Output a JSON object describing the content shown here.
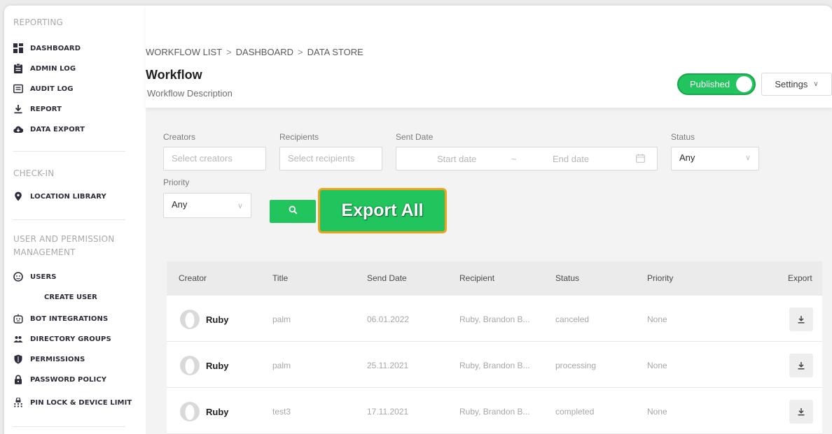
{
  "sidebar": {
    "sections": [
      {
        "title": "REPORTING",
        "items": [
          {
            "label": "DASHBOARD",
            "icon": "dashboard-grid-icon"
          },
          {
            "label": "ADMIN LOG",
            "icon": "clipboard-icon"
          },
          {
            "label": "AUDIT LOG",
            "icon": "list-box-icon"
          },
          {
            "label": "REPORT",
            "icon": "download-arrow-icon"
          },
          {
            "label": "DATA EXPORT",
            "icon": "cloud-download-icon"
          }
        ]
      },
      {
        "title": "CHECK-IN",
        "items": [
          {
            "label": "LOCATION LIBRARY",
            "icon": "location-pin-icon"
          }
        ]
      },
      {
        "title": "USER AND PERMISSION MANAGEMENT",
        "items": [
          {
            "label": "USERS",
            "icon": "user-circle-icon"
          },
          {
            "label": "CREATE USER"
          },
          {
            "label": "BOT INTEGRATIONS",
            "icon": "bot-icon"
          },
          {
            "label": "DIRECTORY GROUPS",
            "icon": "group-icon"
          },
          {
            "label": "PERMISSIONS",
            "icon": "shield-icon"
          },
          {
            "label": "PASSWORD POLICY",
            "icon": "lock-icon"
          },
          {
            "label": "PIN LOCK & DEVICE LIMIT",
            "icon": "pin-keypad-icon"
          }
        ]
      }
    ]
  },
  "header": {
    "breadcrumb": [
      "WORKFLOW LIST",
      "DASHBOARD",
      "DATA STORE"
    ],
    "breadcrumb_sep": ">",
    "title": "Workflow",
    "description": "Workflow Description",
    "published_label": "Published",
    "settings_label": "Settings",
    "chevron": "∨"
  },
  "filters": {
    "creators_label": "Creators",
    "creators_placeholder": "Select creators",
    "recipients_label": "Recipients",
    "recipients_placeholder": "Select recipients",
    "sent_date_label": "Sent Date",
    "start_date_placeholder": "Start date",
    "range_sep": "~",
    "end_date_placeholder": "End date",
    "status_label": "Status",
    "status_value": "Any",
    "priority_label": "Priority",
    "priority_value": "Any",
    "export_all_label": "Export All"
  },
  "table": {
    "columns": [
      "Creator",
      "Title",
      "Send Date",
      "Recipient",
      "Status",
      "Priority",
      "Export"
    ],
    "rows": [
      {
        "creator": "Ruby",
        "title": "palm",
        "send_date": "06.01.2022",
        "recipient": "Ruby, Brandon B...",
        "status": "canceled",
        "priority": "None"
      },
      {
        "creator": "Ruby",
        "title": "palm",
        "send_date": "25.11.2021",
        "recipient": "Ruby, Brandon B...",
        "status": "processing",
        "priority": "None"
      },
      {
        "creator": "Ruby",
        "title": "test3",
        "send_date": "17.11.2021",
        "recipient": "Ruby, Brandon B...",
        "status": "completed",
        "priority": "None"
      }
    ]
  },
  "colors": {
    "accent_green": "#21c45d",
    "highlight_orange": "#f1a21c",
    "sidebar_text": "#2c2c3a",
    "section_title": "#a9a9a9"
  }
}
